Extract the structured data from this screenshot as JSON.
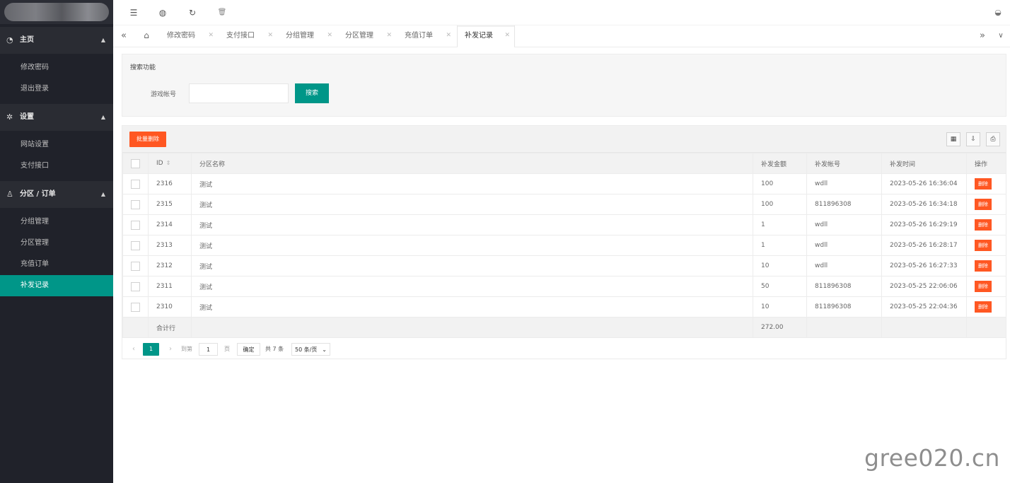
{
  "header": {
    "icons": [
      "menu-fold-icon",
      "globe-icon",
      "refresh-icon",
      "trash-icon",
      "theme-icon"
    ]
  },
  "sidebar": {
    "sections": [
      {
        "icon": "dashboard-icon",
        "label": "主页",
        "items": [
          "修改密码",
          "退出登录"
        ]
      },
      {
        "icon": "gear-icon",
        "label": "设置",
        "items": [
          "网站设置",
          "支付接口"
        ]
      },
      {
        "icon": "user-icon",
        "label": "分区 / 订单",
        "items": [
          "分组管理",
          "分区管理",
          "充值订单",
          "补发记录"
        ]
      }
    ],
    "active_item": "补发记录"
  },
  "tabs": {
    "items": [
      "修改密码",
      "支付接口",
      "分组管理",
      "分区管理",
      "充值订单",
      "补发记录"
    ],
    "active": "补发记录"
  },
  "search": {
    "title": "搜索功能",
    "account_label": "游戏帐号",
    "account_value": "",
    "button": "搜索"
  },
  "table": {
    "batch_delete": "批量删除",
    "columns": [
      "ID",
      "分区名称",
      "补发金额",
      "补发帐号",
      "补发时间",
      "操作"
    ],
    "rows": [
      {
        "id": "2316",
        "zone": "测试",
        "amount": "100",
        "account": "wdll",
        "time": "2023-05-26 16:36:04"
      },
      {
        "id": "2315",
        "zone": "测试",
        "amount": "100",
        "account": "811896308",
        "time": "2023-05-26 16:34:18"
      },
      {
        "id": "2314",
        "zone": "测试",
        "amount": "1",
        "account": "wdll",
        "time": "2023-05-26 16:29:19"
      },
      {
        "id": "2313",
        "zone": "测试",
        "amount": "1",
        "account": "wdll",
        "time": "2023-05-26 16:28:17"
      },
      {
        "id": "2312",
        "zone": "测试",
        "amount": "10",
        "account": "wdll",
        "time": "2023-05-26 16:27:33"
      },
      {
        "id": "2311",
        "zone": "测试",
        "amount": "50",
        "account": "811896308",
        "time": "2023-05-25 22:06:06"
      },
      {
        "id": "2310",
        "zone": "测试",
        "amount": "10",
        "account": "811896308",
        "time": "2023-05-25 22:04:36"
      }
    ],
    "row_action": "删除",
    "summary_label": "合计行",
    "summary_amount": "272.00"
  },
  "pager": {
    "current": "1",
    "goto_label": "到第",
    "goto_value": "1",
    "page_label": "页",
    "confirm": "确定",
    "total": "共 7 条",
    "page_size": "50 条/页"
  },
  "watermark": "gree020.cn",
  "colors": {
    "accent": "#009688",
    "danger": "#ff5722",
    "sidebar_bg": "#20222a"
  }
}
